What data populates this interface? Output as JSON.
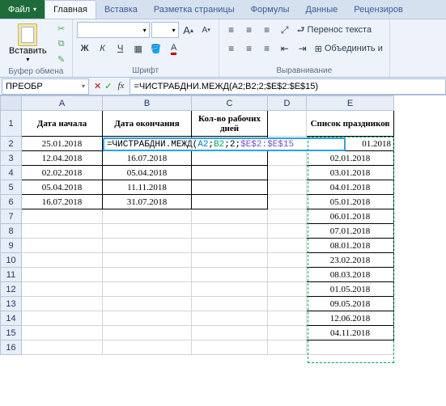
{
  "tabs": {
    "file": "Файл",
    "home": "Главная",
    "insert": "Вставка",
    "pagelayout": "Разметка страницы",
    "formulas": "Формулы",
    "data": "Данные",
    "review": "Рецензиров"
  },
  "clipboard": {
    "paste": "Вставить",
    "group": "Буфер обмена"
  },
  "font": {
    "name": "",
    "size": "",
    "aplus": "A",
    "aminus": "A",
    "group": "Шрифт"
  },
  "align": {
    "wrap": "Перенос текста",
    "merge": "Объединить и",
    "group": "Выравнивание"
  },
  "namebox": "ПРЕОБР",
  "formula_bar": "=ЧИСТРАБДНИ.МЕЖД(A2;B2;2;$E$2:$E$15)",
  "columns": [
    "A",
    "B",
    "C",
    "D",
    "E"
  ],
  "rows_numbers": [
    "1",
    "2",
    "3",
    "4",
    "5",
    "6",
    "7",
    "8",
    "9",
    "10",
    "11",
    "12",
    "13",
    "14",
    "15",
    "16"
  ],
  "headers": {
    "A": "Дата начала",
    "B": "Дата окончания",
    "C": "Кол-во рабочих дней",
    "D": "",
    "E": "Список праздников"
  },
  "colA": [
    "25.01.2018",
    "12.04.2018",
    "02.02.2018",
    "05.04.2018",
    "16.07.2018"
  ],
  "colB": [
    "",
    "16.07.2018",
    "05.04.2018",
    "11.11.2018",
    "31.07.2018"
  ],
  "colE": [
    "01.2018",
    "02.01.2018",
    "03.01.2018",
    "04.01.2018",
    "05.01.2018",
    "06.01.2018",
    "07.01.2018",
    "08.01.2018",
    "23.02.2018",
    "08.03.2018",
    "01.05.2018",
    "09.05.2018",
    "12.06.2018",
    "04.11.2018"
  ],
  "inline_formula": {
    "fn": "=ЧИСТРАБДНИ.МЕЖД(",
    "a": "A2",
    "b": "B2",
    "c": "2",
    "d": "$E$2:$E$15",
    "close": ""
  },
  "colwidths": {
    "A": 100,
    "B": 110,
    "C": 94,
    "D": 48,
    "E": 108
  }
}
